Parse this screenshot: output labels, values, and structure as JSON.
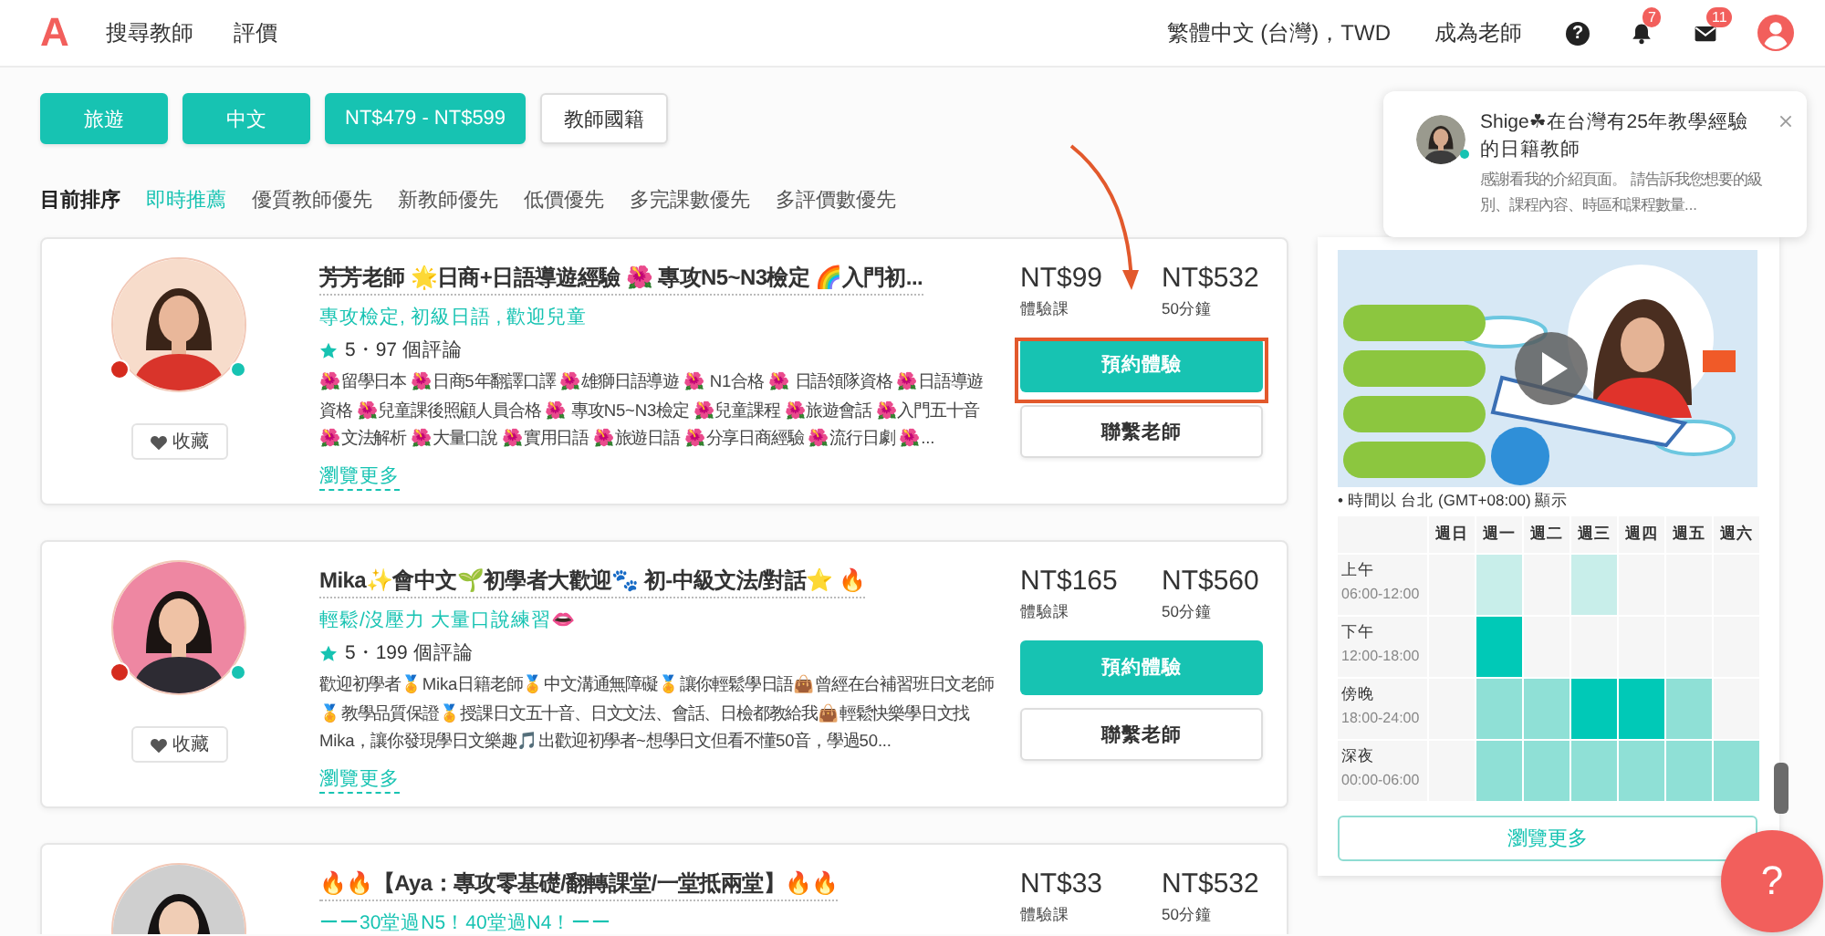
{
  "header": {
    "logo": "A",
    "nav": [
      {
        "label": "搜尋教師"
      },
      {
        "label": "評價"
      }
    ],
    "language": "繁體中文 (台灣)，TWD",
    "become_teacher": "成為老師",
    "help": "?",
    "notifications": "7",
    "messages": "11"
  },
  "filters": [
    {
      "label": "旅遊",
      "selected": true
    },
    {
      "label": "中文",
      "selected": true
    },
    {
      "label": "NT$479 - NT$599",
      "selected": true
    },
    {
      "label": "教師國籍",
      "selected": false
    }
  ],
  "sort": {
    "label": "目前排序",
    "options": [
      {
        "label": "即時推薦",
        "selected": true
      },
      {
        "label": "優質教師優先",
        "selected": false
      },
      {
        "label": "新教師優先",
        "selected": false
      },
      {
        "label": "低價優先",
        "selected": false
      },
      {
        "label": "多完課數優先",
        "selected": false
      },
      {
        "label": "多評價數優先",
        "selected": false
      }
    ]
  },
  "teachers": [
    {
      "title": "芳芳老師 🌟日商+日語導遊經驗 🌺 專攻N5~N3檢定 🌈入門初...",
      "tags": "專攻檢定, 初級日語 , 歡迎兒童",
      "rating": "5・97 個評論",
      "description": "🌺留學日本 🌺日商5年翻譯口譯 🌺雄獅日語導遊 🌺 N1合格 🌺 日語領隊資格 🌺日語導遊資格 🌺兒童課後照顧人員合格 🌺 專攻N5~N3檢定 🌺兒童課程 🌺旅遊會話 🌺入門五十音 🌺文法解析 🌺大量口說 🌺實用日語 🌺旅遊日語 🌺分享日商經驗 🌺流行日劇 🌺...",
      "more": "瀏覽更多",
      "favorite": "收藏",
      "trial_price": "NT$99",
      "trial_label": "體驗課",
      "price": "NT$532",
      "price_label": "50分鐘",
      "book": "預約體驗",
      "contact": "聯繫老師",
      "online": true,
      "highlighted": true
    },
    {
      "title": "Mika✨會中文🌱初學者大歡迎🐾 初-中級文法/對話⭐  🔥",
      "tags": "輕鬆/沒壓力 大量口說練習👄",
      "rating": "5・199 個評論",
      "description": "歡迎初學者🏅Mika日籍老師🏅中文溝通無障礙🏅讓你輕鬆學日語👜曾經在台補習班日文老師🏅教學品質保證🏅授課日文五十音、日文文法、會話、日檢都教給我👜輕鬆快樂學日文找Mika，讓你發現學日文樂趣🎵出歡迎初學者~想學日文但看不懂50音，學過50...",
      "more": "瀏覽更多",
      "favorite": "收藏",
      "trial_price": "NT$165",
      "trial_label": "體驗課",
      "price": "NT$560",
      "price_label": "50分鐘",
      "book": "預約體驗",
      "contact": "聯繫老師",
      "online": true,
      "highlighted": false
    },
    {
      "title": "🔥🔥【Aya：專攻零基礎/翻轉課堂/一堂抵兩堂】🔥🔥",
      "tags": "ーー30堂過N5！40堂過N4！ーー",
      "trial_price": "NT$33",
      "trial_label": "體驗課",
      "price": "NT$532",
      "price_label": "50分鐘"
    }
  ],
  "message_popup": {
    "title": "Shige☘在台灣有25年教學經驗的日籍教師",
    "preview": "感謝看我的介紹頁面。 請告訴我您想要的級別、課程內容、時區和課程數量...",
    "online": true
  },
  "schedule_panel": {
    "timezone_note": "• 時間以 台北 (GMT+08:00) 顯示",
    "days": [
      "週日",
      "週一",
      "週二",
      "週三",
      "週四",
      "週五",
      "週六"
    ],
    "slots": [
      {
        "name": "上午",
        "time": "06:00-12:00",
        "cells": [
          {
            "color": "#f6f6f6"
          },
          {
            "color": "#c8eeea"
          },
          {
            "color": "#f6f6f6"
          },
          {
            "color": "#c8eeea"
          },
          {
            "color": "#f6f6f6"
          },
          {
            "color": "#f6f6f6"
          },
          {
            "color": "#f6f6f6"
          }
        ]
      },
      {
        "name": "下午",
        "time": "12:00-18:00",
        "cells": [
          {
            "color": "#f6f6f6"
          },
          {
            "color": "#00c9b7"
          },
          {
            "color": "#f6f6f6"
          },
          {
            "color": "#f6f6f6"
          },
          {
            "color": "#f6f6f6"
          },
          {
            "color": "#f6f6f6"
          },
          {
            "color": "#f6f6f6"
          }
        ]
      },
      {
        "name": "傍晚",
        "time": "18:00-24:00",
        "cells": [
          {
            "color": "#f6f6f6"
          },
          {
            "color": "#8fe0d6"
          },
          {
            "color": "#8fe0d6"
          },
          {
            "color": "#00c9b7"
          },
          {
            "color": "#00c9b7"
          },
          {
            "color": "#8fe0d6"
          },
          {
            "color": "#f6f6f6"
          }
        ]
      },
      {
        "name": "深夜",
        "time": "00:00-06:00",
        "cells": [
          {
            "color": "#f6f6f6"
          },
          {
            "color": "#8fe0d6"
          },
          {
            "color": "#8fe0d6"
          },
          {
            "color": "#8fe0d6"
          },
          {
            "color": "#8fe0d6"
          },
          {
            "color": "#8fe0d6"
          },
          {
            "color": "#8fe0d6"
          }
        ]
      }
    ],
    "more": "瀏覽更多"
  },
  "help_button": "?"
}
